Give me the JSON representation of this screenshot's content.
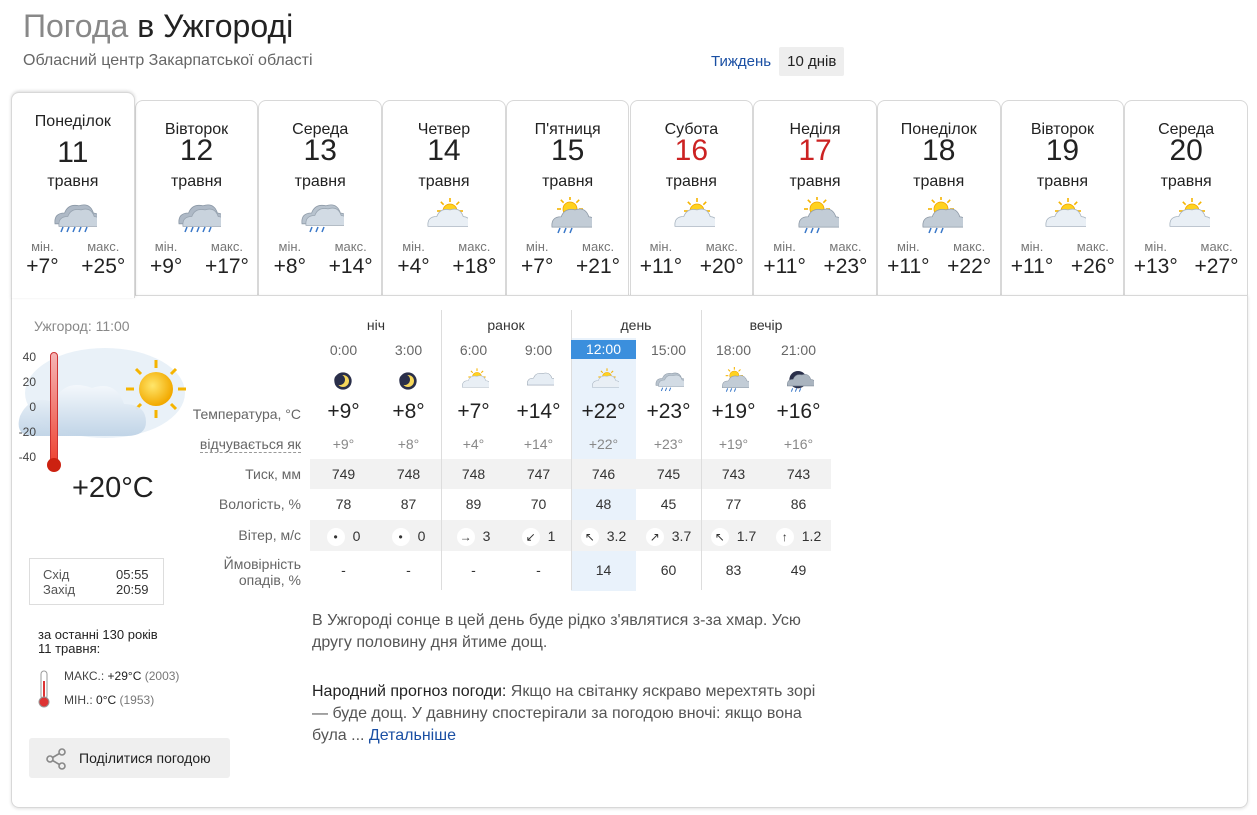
{
  "header": {
    "title_prefix": "Погода",
    "title_place": "в Ужгороді",
    "subtitle": "Обласний центр Закарпатської області",
    "range_week": "Тиждень",
    "range_10days": "10 днів"
  },
  "days": [
    {
      "name": "Понеділок",
      "num": "11",
      "month": "травня",
      "min_label": "мін.",
      "max_label": "макс.",
      "tmin": "+7°",
      "tmax": "+25°",
      "icon": "cloud-heavy-rain-icon",
      "weekend": false,
      "active": true
    },
    {
      "name": "Вівторок",
      "num": "12",
      "month": "травня",
      "min_label": "мін.",
      "max_label": "макс.",
      "tmin": "+9°",
      "tmax": "+17°",
      "icon": "cloud-heavy-rain-icon",
      "weekend": false,
      "active": false
    },
    {
      "name": "Середа",
      "num": "13",
      "month": "травня",
      "min_label": "мін.",
      "max_label": "макс.",
      "tmin": "+8°",
      "tmax": "+14°",
      "icon": "cloud-rain-icon",
      "weekend": false,
      "active": false
    },
    {
      "name": "Четвер",
      "num": "14",
      "month": "травня",
      "min_label": "мін.",
      "max_label": "макс.",
      "tmin": "+4°",
      "tmax": "+18°",
      "icon": "sun-cloud-icon",
      "weekend": false,
      "active": false
    },
    {
      "name": "П'ятниця",
      "num": "15",
      "month": "травня",
      "min_label": "мін.",
      "max_label": "макс.",
      "tmin": "+7°",
      "tmax": "+21°",
      "icon": "sun-cloud-rain-icon",
      "weekend": false,
      "active": false
    },
    {
      "name": "Субота",
      "num": "16",
      "month": "травня",
      "min_label": "мін.",
      "max_label": "макс.",
      "tmin": "+11°",
      "tmax": "+20°",
      "icon": "sun-cloud-icon",
      "weekend": true,
      "active": false
    },
    {
      "name": "Неділя",
      "num": "17",
      "month": "травня",
      "min_label": "мін.",
      "max_label": "макс.",
      "tmin": "+11°",
      "tmax": "+23°",
      "icon": "sun-cloud-rain-icon",
      "weekend": true,
      "active": false
    },
    {
      "name": "Понеділок",
      "num": "18",
      "month": "травня",
      "min_label": "мін.",
      "max_label": "макс.",
      "tmin": "+11°",
      "tmax": "+22°",
      "icon": "sun-cloud-rain-icon",
      "weekend": false,
      "active": false
    },
    {
      "name": "Вівторок",
      "num": "19",
      "month": "травня",
      "min_label": "мін.",
      "max_label": "макс.",
      "tmin": "+11°",
      "tmax": "+26°",
      "icon": "sun-cloud-icon",
      "weekend": false,
      "active": false
    },
    {
      "name": "Середа",
      "num": "20",
      "month": "травня",
      "min_label": "мін.",
      "max_label": "макс.",
      "tmin": "+13°",
      "tmax": "+27°",
      "icon": "sun-cloud-icon",
      "weekend": false,
      "active": false
    }
  ],
  "now": {
    "time_label": "Ужгород: 11:00",
    "temp": "+20°C",
    "scale": [
      "40",
      "20",
      "0",
      "-20",
      "-40"
    ],
    "icon": "sun-behind-clouds-icon"
  },
  "sun": {
    "rise_label": "Схід",
    "rise": "05:55",
    "set_label": "Захід",
    "set": "20:59"
  },
  "history": {
    "title": "за останні 130 років",
    "date": "11 травня:",
    "max_label": "МАКС.:",
    "max_val": "+29°C",
    "max_year": "(2003)",
    "min_label": "МІН.:",
    "min_val": "0°C",
    "min_year": "(1953)"
  },
  "share_label": "Поділитися погодою",
  "forecast": {
    "periods": [
      "ніч",
      "ранок",
      "день",
      "вечір"
    ],
    "row_labels": {
      "temp": "Температура, °C",
      "feel": "відчувається як",
      "press": "Тиск, мм",
      "hum": "Вологість, %",
      "wind": "Вітер, м/с",
      "prec1": "Ймовірність",
      "prec2": "опадів, %"
    },
    "hours": [
      {
        "time": "0:00",
        "icon": "moon-icon",
        "temp": "+9°",
        "feel": "+9°",
        "press": "749",
        "hum": "78",
        "wind_dir": "calm",
        "wind_arrow": "•",
        "wind": "0",
        "prec": "-"
      },
      {
        "time": "3:00",
        "icon": "moon-icon",
        "temp": "+8°",
        "feel": "+8°",
        "press": "748",
        "hum": "87",
        "wind_dir": "calm",
        "wind_arrow": "•",
        "wind": "0",
        "prec": "-"
      },
      {
        "time": "6:00",
        "icon": "sun-cloud-icon",
        "temp": "+7°",
        "feel": "+4°",
        "press": "748",
        "hum": "89",
        "wind_dir": "east",
        "wind_arrow": "→",
        "wind": "3",
        "prec": "-"
      },
      {
        "time": "9:00",
        "icon": "cloud-icon",
        "temp": "+14°",
        "feel": "+14°",
        "press": "747",
        "hum": "70",
        "wind_dir": "south-west",
        "wind_arrow": "↙",
        "wind": "1",
        "prec": "-"
      },
      {
        "time": "12:00",
        "icon": "sun-cloud-icon",
        "temp": "+22°",
        "feel": "+22°",
        "press": "746",
        "hum": "48",
        "wind_dir": "north-west",
        "wind_arrow": "↖",
        "wind": "3.2",
        "prec": "14"
      },
      {
        "time": "15:00",
        "icon": "cloud-rain-icon",
        "temp": "+23°",
        "feel": "+23°",
        "press": "745",
        "hum": "45",
        "wind_dir": "north-east",
        "wind_arrow": "↗",
        "wind": "3.7",
        "prec": "60"
      },
      {
        "time": "18:00",
        "icon": "sun-cloud-rain-icon",
        "temp": "+19°",
        "feel": "+19°",
        "press": "743",
        "hum": "77",
        "wind_dir": "north-west",
        "wind_arrow": "↖",
        "wind": "1.7",
        "prec": "83"
      },
      {
        "time": "21:00",
        "icon": "night-cloud-rain-icon",
        "temp": "+16°",
        "feel": "+16°",
        "press": "743",
        "hum": "86",
        "wind_dir": "north",
        "wind_arrow": "↑",
        "wind": "1.2",
        "prec": "49"
      }
    ],
    "current_hour_index": 4
  },
  "description": "В Ужгороді сонце в цей день буде рідко з'являтися з-за хмар. Усю другу половину дня йтиме дощ.",
  "folk": {
    "label": "Народний прогноз погоди:",
    "text": " Якщо на світанку яскраво мерехтять зорі — буде дощ. У давнину спостерігали за погодою вночі: якщо вона була ... ",
    "more": "Детальніше"
  },
  "colors": {
    "accent": "#3b8fdd",
    "link": "#1a4fa3",
    "weekend": "#cc2222"
  }
}
